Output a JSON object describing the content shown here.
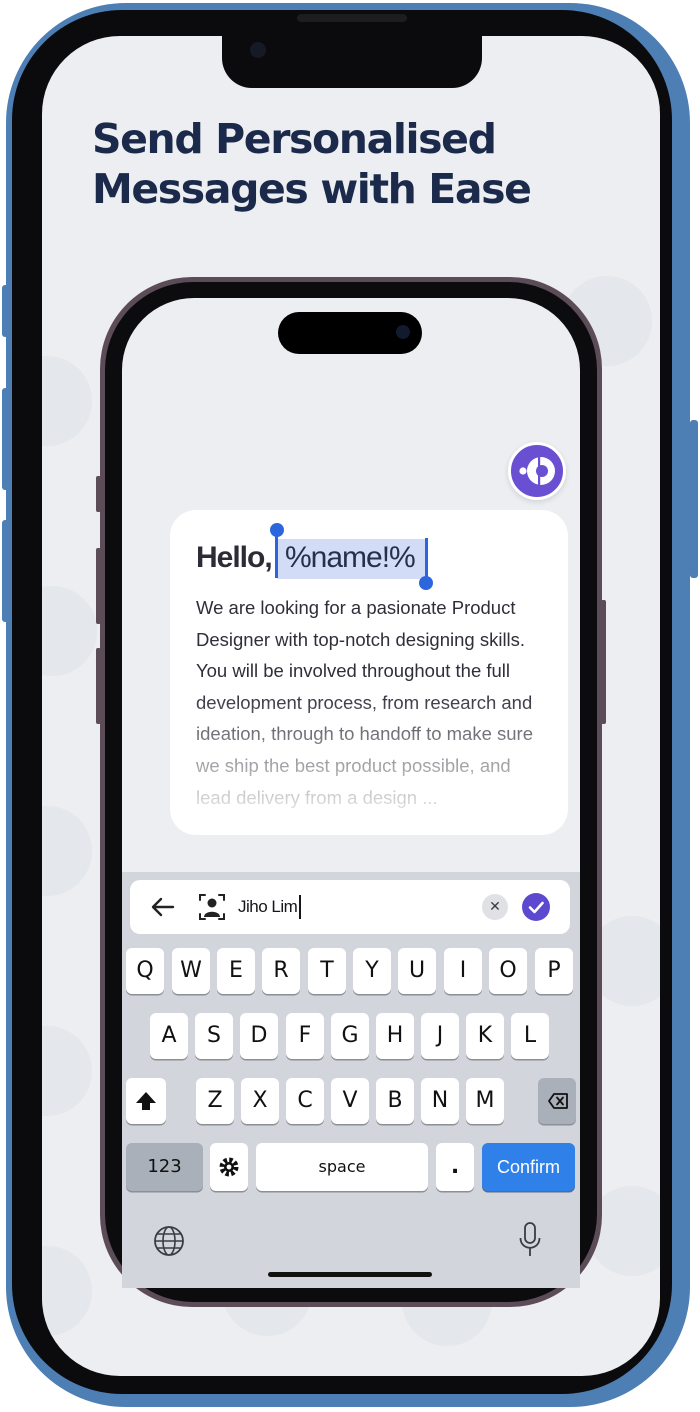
{
  "headline": [
    "Send Personalised",
    "Messages with Ease"
  ],
  "message": {
    "greeting": "Hello,",
    "token": "%name!%",
    "body": "We are looking for a pasionate Product Designer with top-notch designing skills. You will be involved throughout the full development process, from research and ideation, through to handoff to make sure we ship the best product possible, and lead delivery from a design ..."
  },
  "input_bar": {
    "value": "Jiho Lim",
    "back_icon": "arrow-left-icon",
    "contact_icon": "contact-scan-icon",
    "clear_icon": "clear-icon",
    "confirm_icon": "check-circle-icon"
  },
  "keyboard": {
    "row1": [
      "Q",
      "W",
      "E",
      "R",
      "T",
      "Y",
      "U",
      "I",
      "O",
      "P"
    ],
    "row2": [
      "A",
      "S",
      "D",
      "F",
      "G",
      "H",
      "J",
      "K",
      "L"
    ],
    "row3": [
      "Z",
      "X",
      "C",
      "V",
      "B",
      "N",
      "M"
    ],
    "numbers_label": "123",
    "space_label": "space",
    "period_label": ".",
    "confirm_label": "Confirm",
    "icons": [
      "shift-icon",
      "backspace-icon",
      "gear-icon",
      "globe-icon",
      "microphone-icon"
    ]
  },
  "colors": {
    "accent": "#6a4fd2",
    "confirm": "#2f80e8",
    "selection": "#d2dcf6",
    "headline": "#1b2a4b",
    "frame": "#4d7fb4"
  }
}
